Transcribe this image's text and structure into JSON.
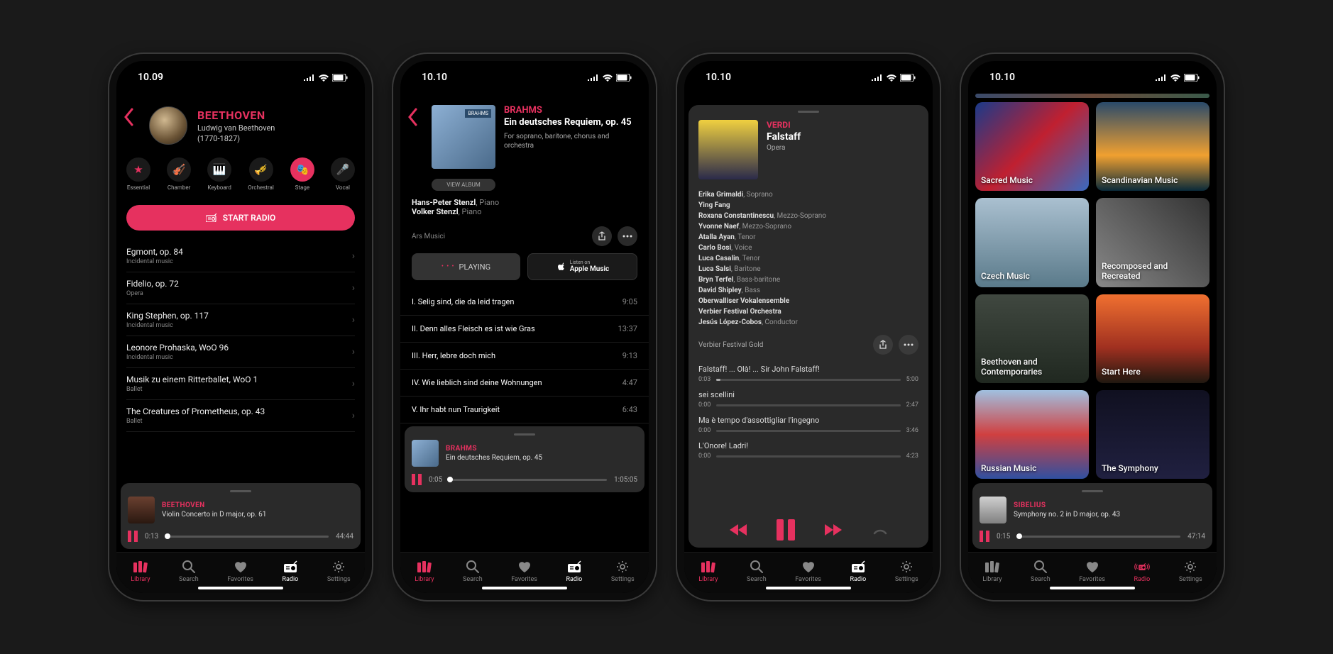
{
  "status": {
    "t1": "10.09",
    "t234": "10.10"
  },
  "tabs": {
    "library": "Library",
    "search": "Search",
    "favorites": "Favorites",
    "radio": "Radio",
    "settings": "Settings"
  },
  "s1": {
    "composer": "BEETHOVEN",
    "full_name": "Ludwig van Beethoven",
    "years": "(1770-1827)",
    "cats": [
      "Essential",
      "Chamber",
      "Keyboard",
      "Orchestral",
      "Stage",
      "Vocal"
    ],
    "start_radio": "START RADIO",
    "works": [
      {
        "t": "Egmont, op. 84",
        "s": "Incidental music"
      },
      {
        "t": "Fidelio, op. 72",
        "s": "Opera"
      },
      {
        "t": "King Stephen, op. 117",
        "s": "Incidental music"
      },
      {
        "t": "Leonore Prohaska, WoO 96",
        "s": "Incidental music"
      },
      {
        "t": "Musik zu einem Ritterballet, WoO 1",
        "s": "Ballet"
      },
      {
        "t": "The Creatures of Prometheus, op. 43",
        "s": "Ballet"
      }
    ],
    "mini": {
      "comp": "BEETHOVEN",
      "title": "Violin Concerto in D major, op. 61",
      "pos": "0:13",
      "dur": "44:44",
      "pct": 1
    }
  },
  "s2": {
    "composer": "BRAHMS",
    "work": "Ein deutsches Requiem, op. 45",
    "desc": "For soprano, baritone, chorus and orchestra",
    "view_album": "VIEW ALBUM",
    "perf1": {
      "n": "Hans-Peter Stenzl",
      "r": "Piano"
    },
    "perf2": {
      "n": "Volker Stenzl",
      "r": "Piano"
    },
    "label": "Ars Musici",
    "playing": "PLAYING",
    "am1": "Listen on",
    "am2": "Apple Music",
    "tracks": [
      {
        "t": "I. Selig sind, die da leid tragen",
        "d": "9:05"
      },
      {
        "t": "II. Denn alles Fleisch es ist wie Gras",
        "d": "13:37"
      },
      {
        "t": "III. Herr, lebre doch mich",
        "d": "9:13"
      },
      {
        "t": "IV. Wie lieblich sind deine Wohnungen",
        "d": "4:47"
      },
      {
        "t": "V. Ihr habt nun Traurigkeit",
        "d": "6:43"
      }
    ],
    "mini": {
      "comp": "BRAHMS",
      "title": "Ein deutsches Requiem, op. 45",
      "pos": "0:05",
      "dur": "1:05:05",
      "pct": 0.5
    }
  },
  "s3": {
    "composer": "VERDI",
    "work": "Falstaff",
    "genre": "Opera",
    "cast": [
      {
        "n": "Erika Grimaldi",
        "r": "Soprano"
      },
      {
        "n": "Ying Fang",
        "r": ""
      },
      {
        "n": "Roxana Constantinescu",
        "r": "Mezzo-Soprano"
      },
      {
        "n": "Yvonne Naef",
        "r": "Mezzo-Soprano"
      },
      {
        "n": "Atalla Ayan",
        "r": "Tenor"
      },
      {
        "n": "Carlo Bosi",
        "r": "Voice"
      },
      {
        "n": "Luca Casalin",
        "r": "Tenor"
      },
      {
        "n": "Luca Salsi",
        "r": "Baritone"
      },
      {
        "n": "Bryn Terfel",
        "r": "Bass-baritone"
      },
      {
        "n": "David Shipley",
        "r": "Bass"
      },
      {
        "n": "Oberwalliser Vokalensemble",
        "r": ""
      },
      {
        "n": "Verbier Festival Orchestra",
        "r": ""
      },
      {
        "n": "Jesús López-Cobos",
        "r": "Conductor"
      }
    ],
    "label": "Verbier Festival Gold",
    "tracks": [
      {
        "t": "Falstaff! ... Olà! ... Sir John Falstaff!",
        "p": "0:03",
        "d": "5:00",
        "pct": 2
      },
      {
        "t": "sei scellini",
        "p": "0:00",
        "d": "2:47",
        "pct": 0
      },
      {
        "t": "Ma è tempo d'assottigliar l'ingegno",
        "p": "0:00",
        "d": "3:46",
        "pct": 0
      },
      {
        "t": "L'Onore! Ladri!",
        "p": "0:00",
        "d": "4:23",
        "pct": 0
      }
    ]
  },
  "s4": {
    "tiles": [
      {
        "l": "Sacred Music",
        "g": "linear-gradient(135deg,#1a3a8a,#c02030 50%,#3a6ac0)"
      },
      {
        "l": "Scandinavian Music",
        "g": "linear-gradient(#2a4a6a,#f0a030 60%,#0a2a3a)"
      },
      {
        "l": "Czech Music",
        "g": "linear-gradient(#aac0d0,#5a7a8a)"
      },
      {
        "l": "Recomposed and Recreated",
        "g": "linear-gradient(45deg,#888,#333)"
      },
      {
        "l": "Beethoven and Contemporaries",
        "g": "linear-gradient(#404840,#202820)"
      },
      {
        "l": "Start Here",
        "g": "linear-gradient(#f07030,#a03020 60%,#201810)"
      },
      {
        "l": "Russian Music",
        "g": "linear-gradient(#a0c0e0,#d04040 50%,#3050a0)"
      },
      {
        "l": "The Symphony",
        "g": "linear-gradient(#101020,#202040)"
      }
    ],
    "mini": {
      "comp": "SIBELIUS",
      "title": "Symphony no. 2 in D major, op. 43",
      "pos": "0:15",
      "dur": "47:14",
      "pct": 1
    }
  }
}
